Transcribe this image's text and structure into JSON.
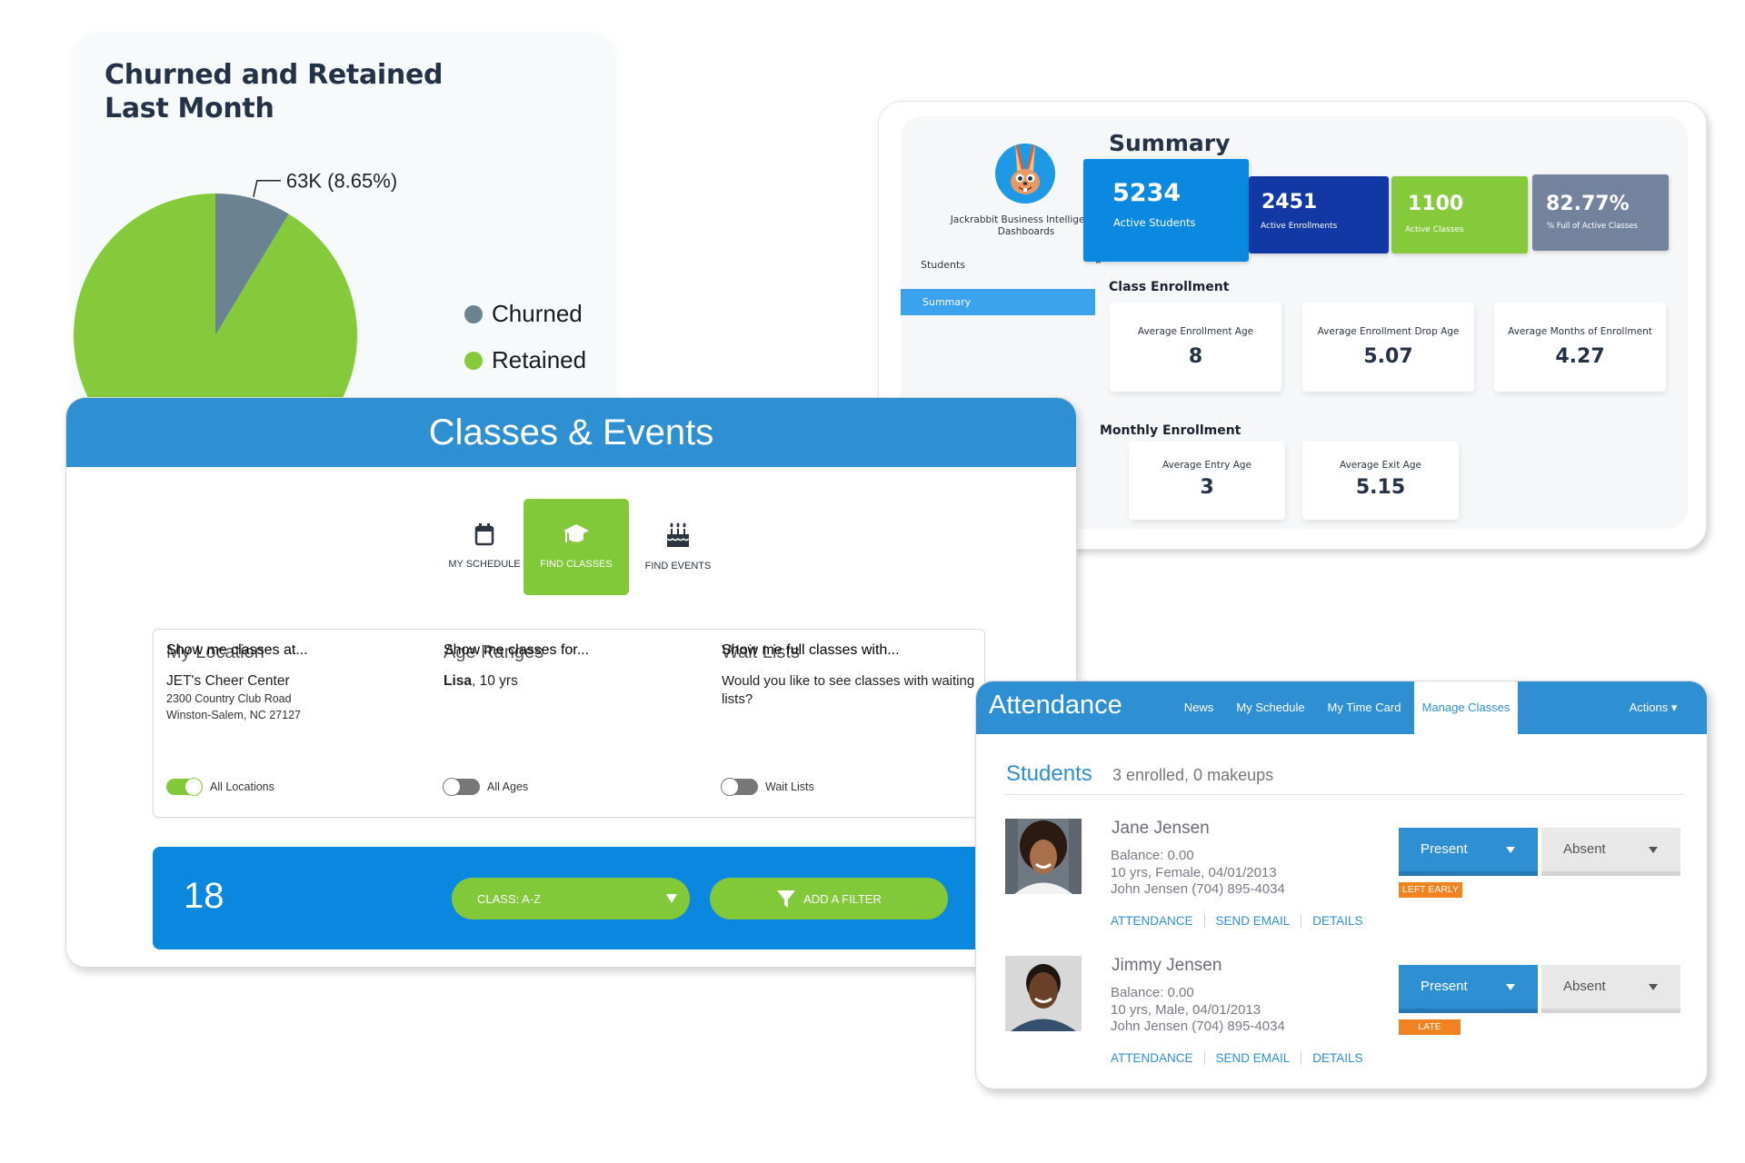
{
  "churn_card": {
    "title": "Churned and Retained Last Month",
    "colors": {
      "churned": "#6b8290",
      "retained": "#84ca3a"
    }
  },
  "chart_data": {
    "type": "pie",
    "title": "Churned and Retained Last Month",
    "slices": [
      {
        "label": "Churned",
        "value": 63,
        "unit": "K",
        "percent": 8.65,
        "color": "#6b8290"
      },
      {
        "label": "Retained",
        "percent": 91.35,
        "color": "#84ca3a"
      }
    ],
    "data_labels": [
      "63K (8.65%)"
    ],
    "legend": {
      "entries": [
        "Churned",
        "Retained"
      ],
      "placement": "right"
    }
  },
  "bi": {
    "brand": "Jackrabbit Business Intelligence Dashboards",
    "nav_students": "Students",
    "nav_summary": "Summary",
    "title": "Summary",
    "kpis": [
      {
        "value": "5234",
        "label": "Active Students",
        "color": "#0b88e0"
      },
      {
        "value": "2451",
        "label": "Active Enrollments",
        "color": "#1238a6"
      },
      {
        "value": "1100",
        "label": "Active Classes",
        "color": "#84ca3a"
      },
      {
        "value": "82.77%",
        "label": "% Full of Active Classes",
        "color": "#74839d"
      }
    ],
    "class_enrollment_title": "Class Enrollment",
    "class_enrollment": [
      {
        "label": "Average Enrollment Age",
        "value": "8"
      },
      {
        "label": "Average Enrollment Drop Age",
        "value": "5.07"
      },
      {
        "label": "Average Months of Enrollment",
        "value": "4.27"
      }
    ],
    "monthly_enrollment_title": "Monthly Enrollment",
    "monthly_enrollment": [
      {
        "label": "Average Entry Age",
        "value": "3"
      },
      {
        "label": "Average Exit Age",
        "value": "5.15"
      }
    ]
  },
  "classes_events": {
    "title": "Classes & Events",
    "tabs": [
      {
        "label": "MY SCHEDULE",
        "icon": "calendar-icon",
        "active": false
      },
      {
        "label": "FIND CLASSES",
        "icon": "graduation-cap-icon",
        "active": true
      },
      {
        "label": "FIND EVENTS",
        "icon": "birthday-cake-icon",
        "active": false
      }
    ],
    "location": {
      "heading": "My Location",
      "name": "JET's Cheer Center",
      "address1": "2300 Country Club Road",
      "address2": "Winston-Salem, NC 27127",
      "caption": "Show me classes at...",
      "toggle_label": "All Locations",
      "toggle_on": true
    },
    "ages": {
      "heading": "Age Ranges",
      "student_name": "Lisa",
      "student_age": ", 10 yrs",
      "caption": "Show me classes for...",
      "toggle_label": "All Ages",
      "toggle_on": false
    },
    "waitlists": {
      "heading": "Wait Lists",
      "question": "Would you like to see classes with waiting lists?",
      "caption": "Show me full classes with...",
      "toggle_label": "Wait Lists",
      "toggle_on": false
    },
    "result_count": "18",
    "sort_label": "CLASS: A-Z",
    "filter_label": "ADD A FILTER"
  },
  "attendance": {
    "title": "Attendance",
    "nav": [
      {
        "label": "News",
        "active": false
      },
      {
        "label": "My Schedule",
        "active": false
      },
      {
        "label": "My Time Card",
        "active": false
      },
      {
        "label": "Manage Classes",
        "active": true
      }
    ],
    "actions_label": "Actions ▾",
    "students_heading": "Students",
    "enrolled_summary": "3 enrolled, 0 makeups",
    "students": [
      {
        "name": "Jane Jensen",
        "balance": "Balance: 0.00",
        "details": "10 yrs, Female, 04/01/2013",
        "contact": "John Jensen (704) 895-4034",
        "present_label": "Present",
        "absent_label": "Absent",
        "badge": "LEFT EARLY",
        "links": [
          "ATTENDANCE",
          "SEND EMAIL",
          "DETAILS"
        ]
      },
      {
        "name": "Jimmy Jensen",
        "balance": "Balance: 0.00",
        "details": "10 yrs, Male, 04/01/2013",
        "contact": "John Jensen (704) 895-4034",
        "present_label": "Present",
        "absent_label": "Absent",
        "badge": "LATE",
        "links": [
          "ATTENDANCE",
          "SEND EMAIL",
          "DETAILS"
        ]
      }
    ]
  }
}
